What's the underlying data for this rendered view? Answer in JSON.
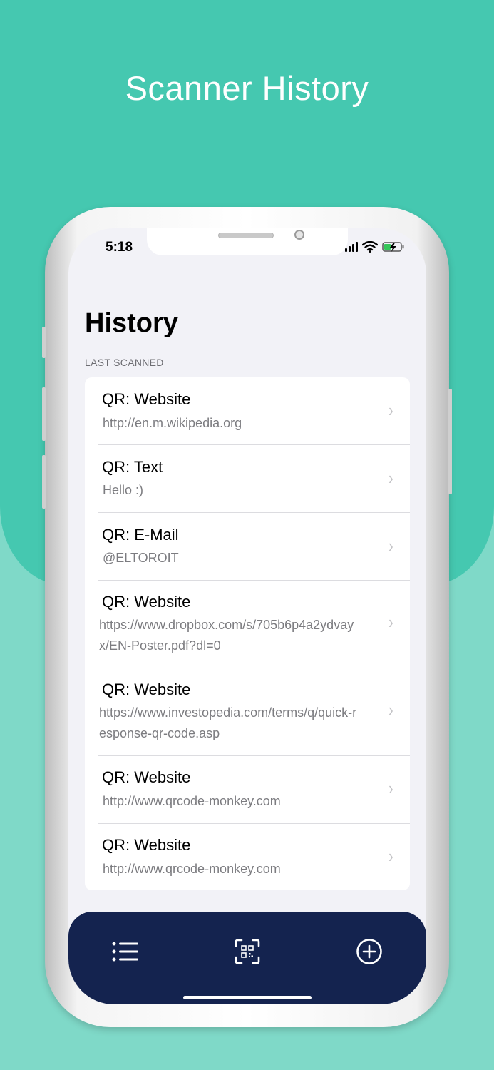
{
  "promo": {
    "title": "Scanner History"
  },
  "status_bar": {
    "time": "5:18",
    "signal_icon": "signal-bars-icon",
    "wifi_icon": "wifi-icon",
    "battery_icon": "battery-charging-icon"
  },
  "screen": {
    "title": "History",
    "section_header": "LAST SCANNED"
  },
  "history": [
    {
      "title": "QR: Website",
      "subtitle": "http://en.m.wikipedia.org"
    },
    {
      "title": "QR: Text",
      "subtitle": "Hello :)"
    },
    {
      "title": "QR: E-Mail",
      "subtitle": "@ELTOROIT"
    },
    {
      "title": "QR: Website",
      "subtitle": "https://www.dropbox.com/s/705b6p4a2ydvayx/EN-Poster.pdf?dl=0"
    },
    {
      "title": "QR: Website",
      "subtitle": "https://www.investopedia.com/terms/q/quick-response-qr-code.asp"
    },
    {
      "title": "QR: Website",
      "subtitle": "http://www.qrcode-monkey.com"
    },
    {
      "title": "QR: Website",
      "subtitle": "http://www.qrcode-monkey.com"
    }
  ],
  "tab_bar": {
    "tabs": [
      {
        "icon": "list-icon"
      },
      {
        "icon": "qr-scan-icon"
      },
      {
        "icon": "plus-circle-icon"
      }
    ]
  },
  "colors": {
    "background_top": "#45c8b0",
    "background_bottom": "#7fd9c8",
    "tab_bar": "#14234f",
    "screen_bg": "#f2f2f7"
  }
}
